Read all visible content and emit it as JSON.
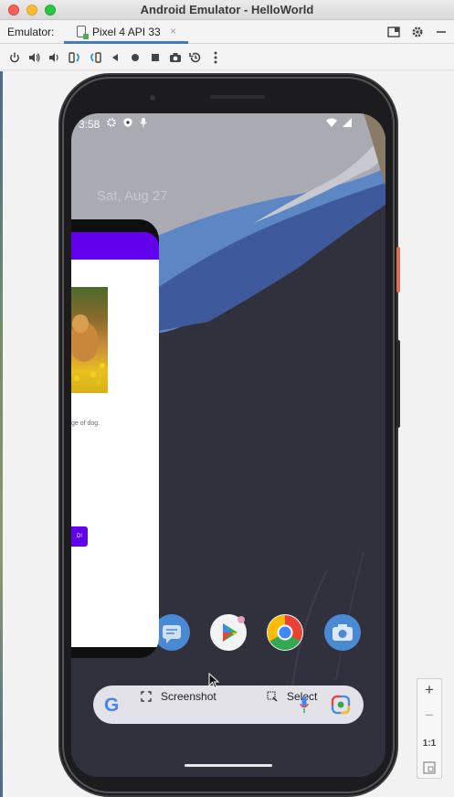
{
  "window": {
    "title": "Android Emulator - HelloWorld"
  },
  "tabbar": {
    "label": "Emulator:",
    "tab_name": "Pixel 4 API 33",
    "tab_close": "×"
  },
  "phone": {
    "status": {
      "time": "3:58"
    },
    "date": "Sat, Aug 27",
    "recent_app": {
      "image_description": "ge of dog.",
      "button_label": "D!"
    },
    "search": {
      "screenshot_label": "Screenshot",
      "select_label": "Select",
      "google_letter": "G"
    }
  },
  "zoom_panel": {
    "zoom_in": "+",
    "zoom_out": "−",
    "actual_size": "1:1"
  },
  "colors": {
    "app_bar": "#6200ee",
    "wallpaper_dark": "#30313d",
    "wallpaper_blue": "#5d87c4",
    "tab_accent": "#3d7ccd"
  }
}
